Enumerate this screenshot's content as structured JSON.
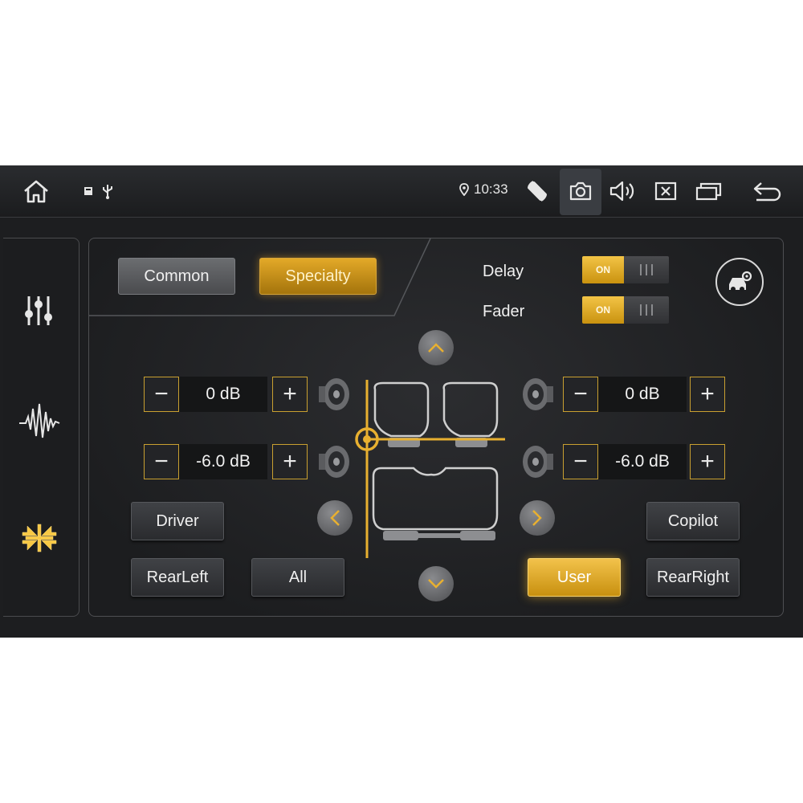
{
  "status_bar": {
    "time": "10:33",
    "icons": [
      "home-icon",
      "storage-icon",
      "usb-icon",
      "location-icon",
      "rotate-icon",
      "camera-icon",
      "volume-icon",
      "close-box-icon",
      "recent-apps-icon",
      "back-icon"
    ]
  },
  "sidebar": {
    "items": [
      {
        "name": "equalizer-sliders-icon",
        "active": false
      },
      {
        "name": "waveform-icon",
        "active": false
      },
      {
        "name": "sound-field-icon",
        "active": true
      }
    ]
  },
  "mode_tabs": {
    "common": "Common",
    "specialty": "Specialty",
    "active": "Specialty"
  },
  "delay": {
    "label": "Delay",
    "state": "ON"
  },
  "fader": {
    "label": "Fader",
    "state": "ON"
  },
  "speakers": {
    "front_left": "0 dB",
    "front_right": "0 dB",
    "rear_left": "-6.0 dB",
    "rear_right": "-6.0 dB"
  },
  "position_buttons": {
    "driver": "Driver",
    "copilot": "Copilot",
    "rear_left": "RearLeft",
    "all": "All",
    "user": "User",
    "rear_right": "RearRight",
    "active": "User"
  },
  "colors": {
    "accent": "#e8b030",
    "background": "#1d1e20"
  }
}
